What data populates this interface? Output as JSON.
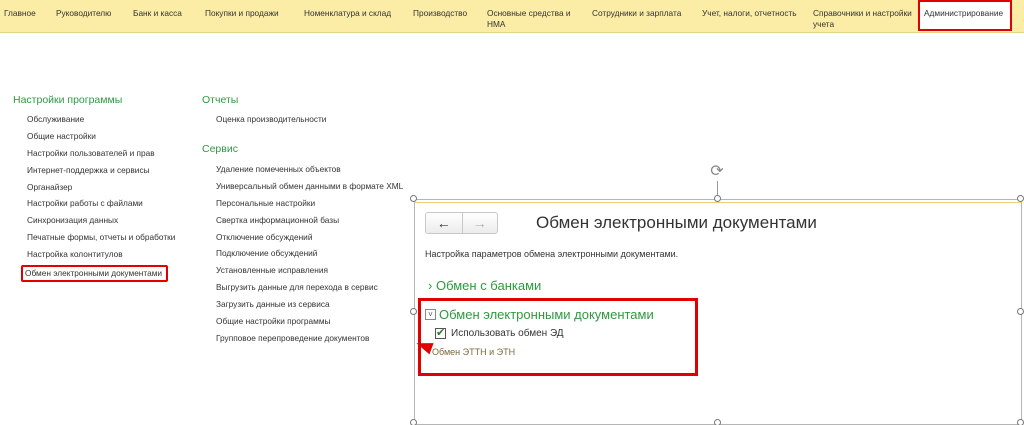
{
  "topmenu": [
    {
      "label": "Главное",
      "selected": false
    },
    {
      "label": "Руководителю",
      "selected": false
    },
    {
      "label": "Банк и касса",
      "selected": false
    },
    {
      "label": "Покупки и продажи",
      "selected": false
    },
    {
      "label": "Номенклатура и склад",
      "selected": false
    },
    {
      "label": "Производство",
      "selected": false
    },
    {
      "label": "Основные средства и НМА",
      "selected": false
    },
    {
      "label": "Сотрудники и зарплата",
      "selected": false
    },
    {
      "label": "Учет, налоги, отчетность",
      "selected": false
    },
    {
      "label": "Справочники и настройки учета",
      "selected": false
    },
    {
      "label": "Администрирование",
      "selected": true
    }
  ],
  "settings": {
    "title": "Настройки программы",
    "items": [
      "Обслуживание",
      "Общие настройки",
      "Настройки пользователей и прав",
      "Интернет-поддержка и сервисы",
      "Органайзер",
      "Настройки работы с файлами",
      "Синхронизация данных",
      "Печатные формы, отчеты и обработки",
      "Настройка колонтитулов",
      "Обмен электронными документами"
    ]
  },
  "reports": {
    "title": "Отчеты",
    "items": [
      "Оценка производительности"
    ]
  },
  "service": {
    "title": "Сервис",
    "items": [
      "Удаление помеченных объектов",
      "Универсальный обмен данными в формате XML",
      "Персональные настройки",
      "Свертка информационной базы",
      "Отключение обсуждений",
      "Подключение обсуждений",
      "Установленные исправления",
      "Выгрузить данные для перехода в сервис",
      "Загрузить данные из сервиса",
      "Общие настройки программы",
      "Групповое перепроведение документов"
    ]
  },
  "form": {
    "title": "Обмен электронными документами",
    "description": "Настройка параметров обмена электронными документами.",
    "nav_back": "←",
    "nav_forward": "→",
    "bank_group": "Обмен с банками",
    "bank_chevron": "›",
    "edo_group": "Обмен электронными документами",
    "edo_collapse": "˅",
    "use_edo_label": "Использовать обмен ЭД",
    "use_edo_checked": true,
    "ettn_link": "Обмен ЭТТН и ЭТН",
    "rotate_glyph": "⟳"
  }
}
